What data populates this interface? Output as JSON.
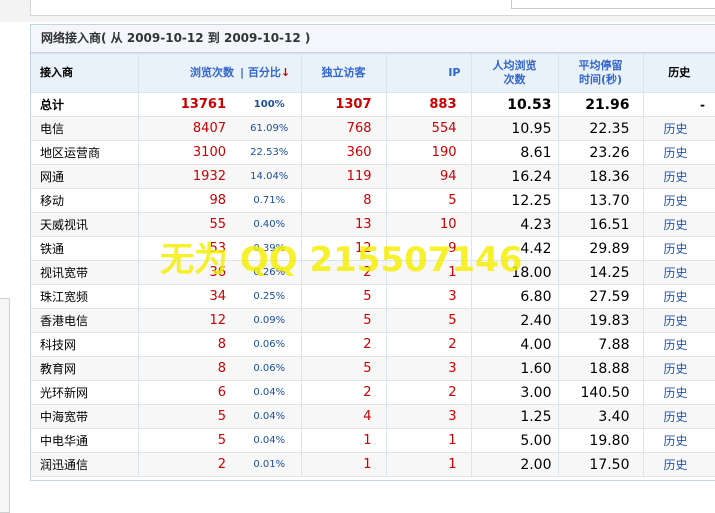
{
  "panel": {
    "title": "网络接入商",
    "range": "( 从   2009-10-12 到   2009-10-12 )"
  },
  "headers": {
    "isp": "接入商",
    "pv": "浏览次数",
    "pct": "| 百分比",
    "pct_arrow": "↓",
    "uv": "独立访客",
    "ip": "IP",
    "avg_line1": "人均浏览",
    "avg_line2": "次数",
    "stay_line1": "平均停留",
    "stay_line2": "时间(秒)",
    "history": "历史"
  },
  "total": {
    "name": "总计",
    "pv": "13761",
    "pct": "100%",
    "uv": "1307",
    "ip": "883",
    "avg": "10.53",
    "stay": "21.96",
    "history": "-"
  },
  "rows": [
    {
      "name": "电信",
      "pv": "8407",
      "pct": "61.09%",
      "uv": "768",
      "ip": "554",
      "avg": "10.95",
      "stay": "22.35",
      "history": "历史"
    },
    {
      "name": "地区运营商",
      "pv": "3100",
      "pct": "22.53%",
      "uv": "360",
      "ip": "190",
      "avg": "8.61",
      "stay": "23.26",
      "history": "历史"
    },
    {
      "name": "网通",
      "pv": "1932",
      "pct": "14.04%",
      "uv": "119",
      "ip": "94",
      "avg": "16.24",
      "stay": "18.36",
      "history": "历史"
    },
    {
      "name": "移动",
      "pv": "98",
      "pct": "0.71%",
      "uv": "8",
      "ip": "5",
      "avg": "12.25",
      "stay": "13.70",
      "history": "历史"
    },
    {
      "name": "天威视讯",
      "pv": "55",
      "pct": "0.40%",
      "uv": "13",
      "ip": "10",
      "avg": "4.23",
      "stay": "16.51",
      "history": "历史"
    },
    {
      "name": "铁通",
      "pv": "53",
      "pct": "0.39%",
      "uv": "12",
      "ip": "9",
      "avg": "4.42",
      "stay": "29.89",
      "history": "历史"
    },
    {
      "name": "视讯宽带",
      "pv": "36",
      "pct": "0.26%",
      "uv": "2",
      "ip": "1",
      "avg": "18.00",
      "stay": "14.25",
      "history": "历史"
    },
    {
      "name": "珠江宽频",
      "pv": "34",
      "pct": "0.25%",
      "uv": "5",
      "ip": "3",
      "avg": "6.80",
      "stay": "27.59",
      "history": "历史"
    },
    {
      "name": "香港电信",
      "pv": "12",
      "pct": "0.09%",
      "uv": "5",
      "ip": "5",
      "avg": "2.40",
      "stay": "19.83",
      "history": "历史"
    },
    {
      "name": "科技网",
      "pv": "8",
      "pct": "0.06%",
      "uv": "2",
      "ip": "2",
      "avg": "4.00",
      "stay": "7.88",
      "history": "历史"
    },
    {
      "name": "教育网",
      "pv": "8",
      "pct": "0.06%",
      "uv": "5",
      "ip": "3",
      "avg": "1.60",
      "stay": "18.88",
      "history": "历史"
    },
    {
      "name": "光环新网",
      "pv": "6",
      "pct": "0.04%",
      "uv": "2",
      "ip": "2",
      "avg": "3.00",
      "stay": "140.50",
      "history": "历史"
    },
    {
      "name": "中海宽带",
      "pv": "5",
      "pct": "0.04%",
      "uv": "4",
      "ip": "3",
      "avg": "1.25",
      "stay": "3.40",
      "history": "历史"
    },
    {
      "name": "中电华通",
      "pv": "5",
      "pct": "0.04%",
      "uv": "1",
      "ip": "1",
      "avg": "5.00",
      "stay": "19.80",
      "history": "历史"
    },
    {
      "name": "润迅通信",
      "pv": "2",
      "pct": "0.01%",
      "uv": "1",
      "ip": "1",
      "avg": "2.00",
      "stay": "17.50",
      "history": "历史"
    }
  ],
  "watermark": "无为 QQ 215507146"
}
